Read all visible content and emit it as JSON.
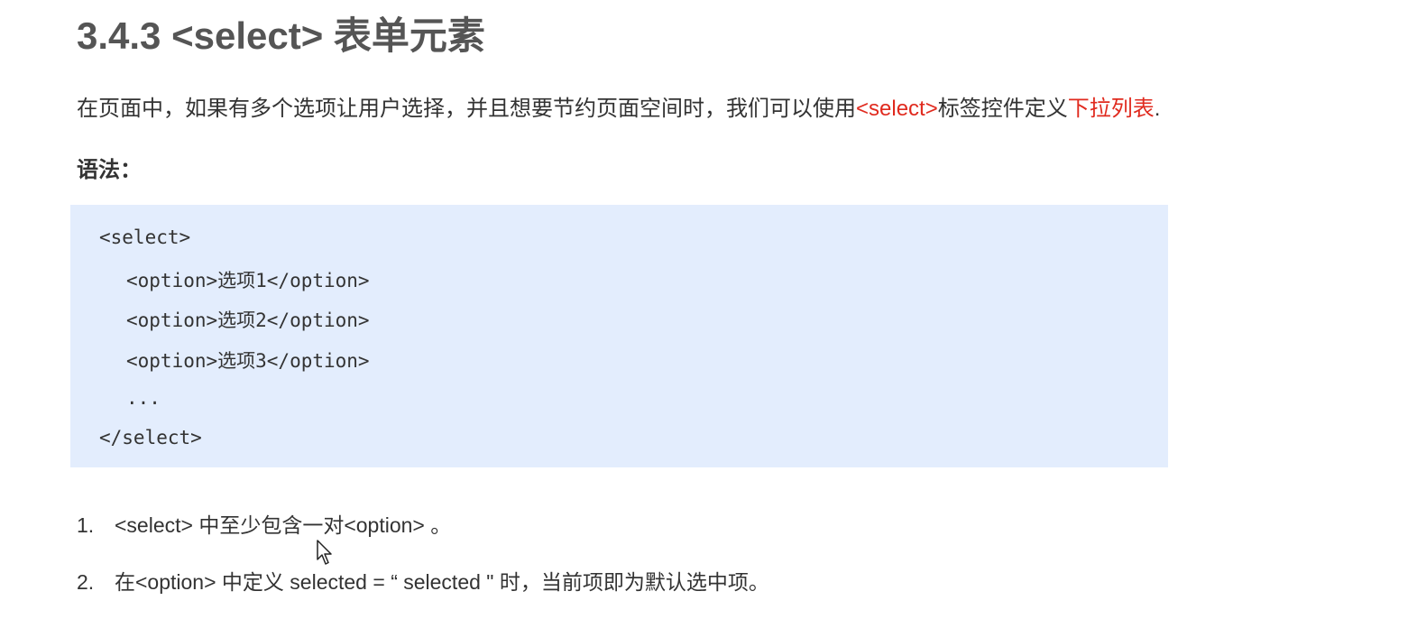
{
  "heading": "3.4.3 <select> 表单元素",
  "intro": {
    "part1": "在页面中，如果有多个选项让用户选择，并且想要节约页面空间时，我们可以使用",
    "highlight1": "<select>",
    "part2": "标签控件定义",
    "highlight2": "下拉列表",
    "part3": "."
  },
  "syntax_label": "语法：",
  "code": {
    "line1": "<select>",
    "line2": "<option>选项1</option>",
    "line3": "<option>选项2</option>",
    "line4": "<option>选项3</option>",
    "line5": "...",
    "line6": "</select>"
  },
  "notes": [
    {
      "num": "1.",
      "text": "<select> 中至少包含一对<option> 。"
    },
    {
      "num": "2.",
      "text": "在<option> 中定义 selected = “ selected \" 时，当前项即为默认选中项。"
    }
  ],
  "colors": {
    "highlight": "#e02a1e",
    "code_bg": "#e3edfd"
  },
  "icons": {
    "cursor": "mouse-pointer-icon"
  }
}
